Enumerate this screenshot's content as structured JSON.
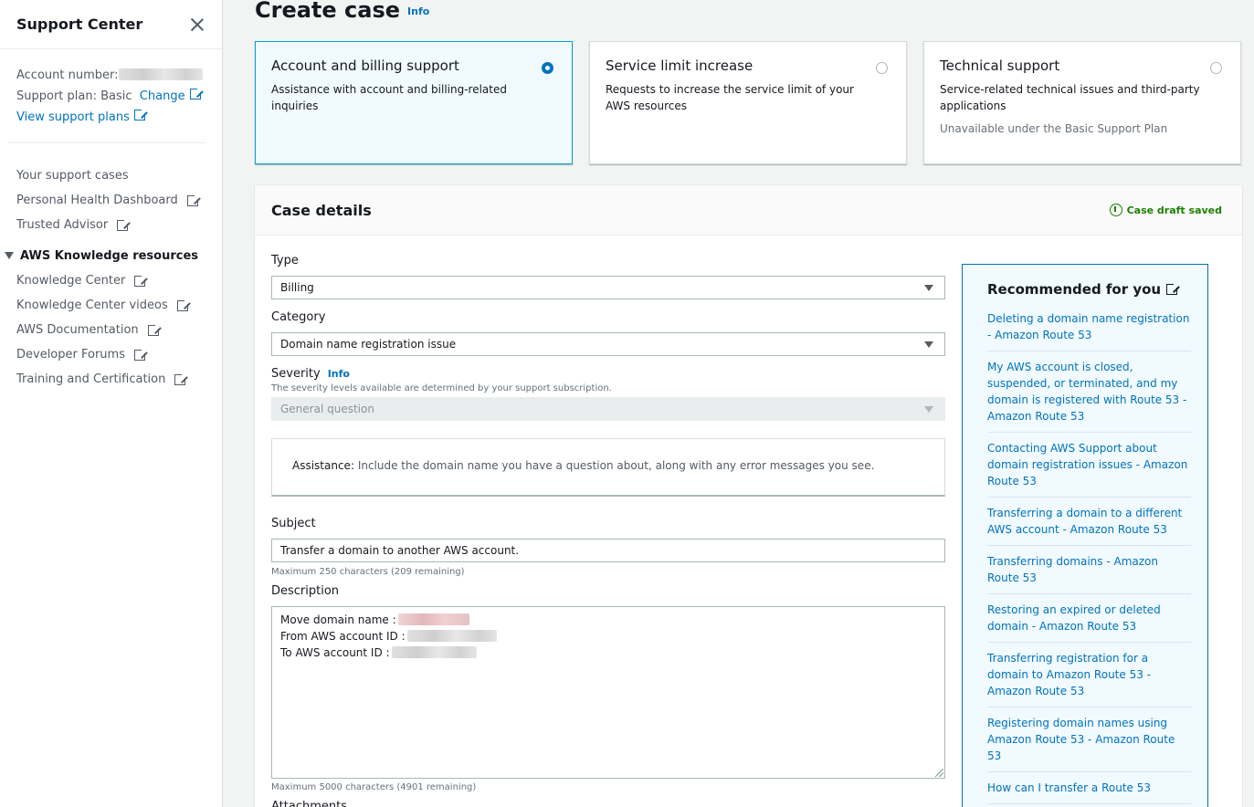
{
  "sidebar": {
    "title": "Support Center",
    "account_label": "Account number:",
    "plan_label": "Support plan: Basic",
    "change_link": "Change",
    "view_plans_link": "View support plans",
    "nav": [
      {
        "label": "Your support cases",
        "external": false
      },
      {
        "label": "Personal Health Dashboard",
        "external": true
      },
      {
        "label": "Trusted Advisor",
        "external": true
      }
    ],
    "section_title": "AWS Knowledge resources",
    "resources": [
      {
        "label": "Knowledge Center"
      },
      {
        "label": "Knowledge Center videos"
      },
      {
        "label": "AWS Documentation"
      },
      {
        "label": "Developer Forums"
      },
      {
        "label": "Training and Certification"
      }
    ]
  },
  "page": {
    "title": "Create case",
    "info": "Info"
  },
  "tiles": [
    {
      "title": "Account and billing support",
      "desc": "Assistance with account and billing-related inquiries",
      "note": "",
      "selected": true
    },
    {
      "title": "Service limit increase",
      "desc": "Requests to increase the service limit of your AWS resources",
      "note": "",
      "selected": false
    },
    {
      "title": "Technical support",
      "desc": "Service-related technical issues and third-party applications",
      "note": "Unavailable under the Basic Support Plan",
      "selected": false
    }
  ],
  "case_details": {
    "title": "Case details",
    "draft_status": "Case draft saved",
    "type_label": "Type",
    "type_value": "Billing",
    "category_label": "Category",
    "category_value": "Domain name registration issue",
    "severity_label": "Severity",
    "severity_info": "Info",
    "severity_hint": "The severity levels available are determined by your support subscription.",
    "severity_value": "General question",
    "assistance_label": "Assistance:",
    "assistance_text": " Include the domain name you have a question about, along with any error messages you see.",
    "subject_label": "Subject",
    "subject_value": "Transfer a domain to another AWS account.",
    "subject_hint": "Maximum 250 characters (209 remaining)",
    "description_label": "Description",
    "description_lines": [
      "Move domain name :",
      "From AWS account ID :",
      "To AWS account ID :"
    ],
    "description_hint": "Maximum 5000 characters (4901 remaining)",
    "attachments_label": "Attachments"
  },
  "recommended": {
    "title": "Recommended for you",
    "items": [
      "Deleting a domain name registration - Amazon Route 53",
      "My AWS account is closed, suspended, or terminated, and my domain is registered with Route 53 - Amazon Route 53",
      "Contacting AWS Support about domain registration issues - Amazon Route 53",
      "Transferring a domain to a different AWS account - Amazon Route 53",
      "Transferring domains - Amazon Route 53",
      "Restoring an expired or deleted domain - Amazon Route 53",
      "Transferring registration for a domain to Amazon Route 53 - Amazon Route 53",
      "Registering domain names using Amazon Route 53 - Amazon Route 53",
      "How can I transfer a Route 53"
    ]
  }
}
